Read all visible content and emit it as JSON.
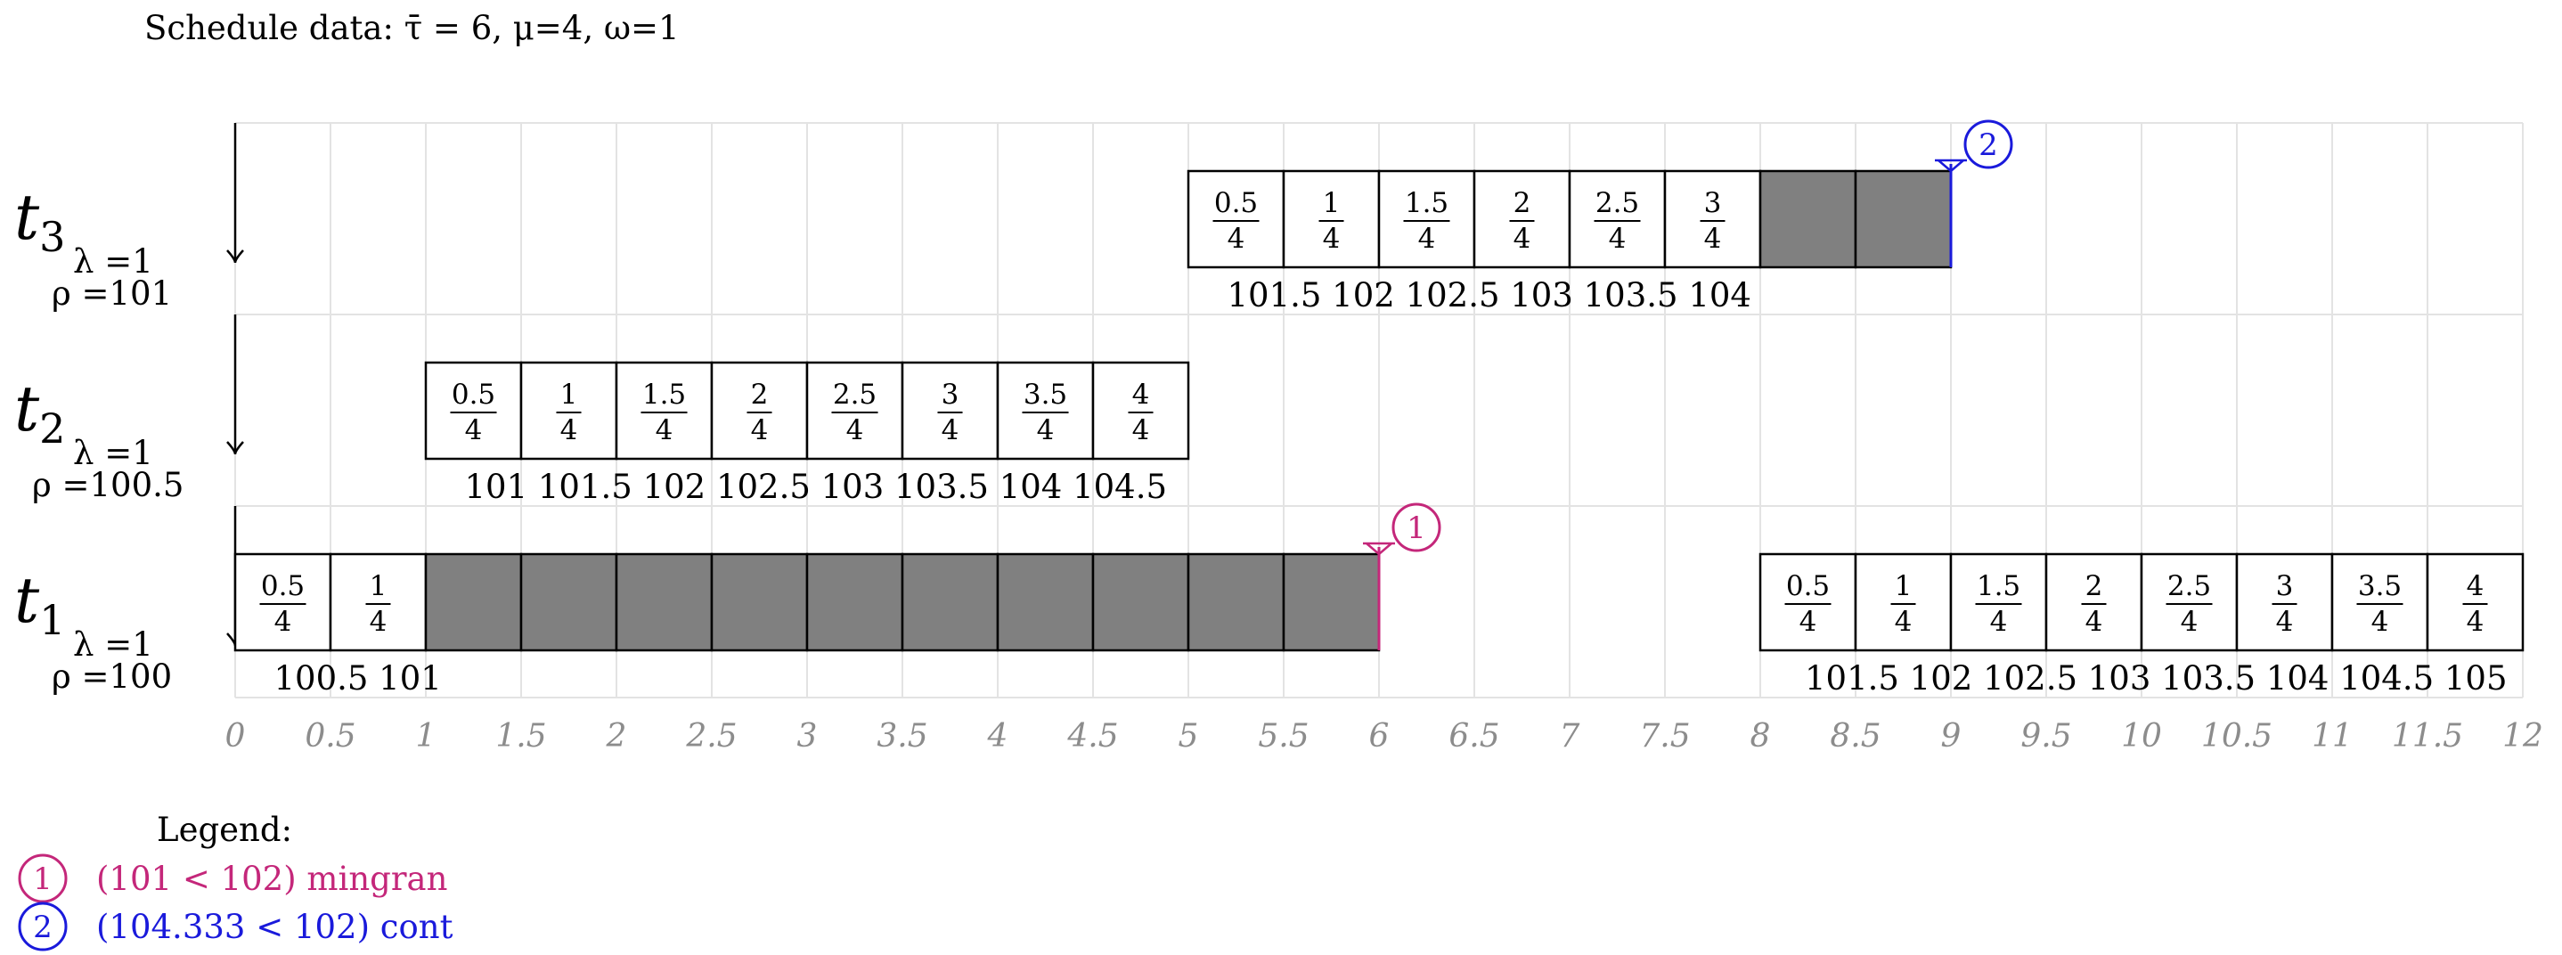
{
  "header": {
    "text": "Schedule data:  τ̄ = 6,  μ=4,  ω=1"
  },
  "axis": {
    "ticks": [
      "0",
      "0.5",
      "1",
      "1.5",
      "2",
      "2.5",
      "3",
      "3.5",
      "4",
      "4.5",
      "5",
      "5.5",
      "6",
      "6.5",
      "7",
      "7.5",
      "8",
      "8.5",
      "9",
      "9.5",
      "10",
      "10.5",
      "11",
      "11.5",
      "12"
    ]
  },
  "rows": [
    {
      "id": "t3",
      "name": "t",
      "sub": "3",
      "lambda": "λ =1",
      "rho": "ρ =101",
      "job_start": 5,
      "blocks": [
        {
          "num": "0.5",
          "den": "4"
        },
        {
          "num": "1",
          "den": "4"
        },
        {
          "num": "1.5",
          "den": "4"
        },
        {
          "num": "2",
          "den": "4"
        },
        {
          "num": "2.5",
          "den": "4"
        },
        {
          "num": "3",
          "den": "4"
        },
        {
          "fill": "gray"
        },
        {
          "fill": "gray"
        }
      ],
      "under_labels": [
        "101.5",
        "102",
        "102.5",
        "103",
        "103.5",
        "104"
      ],
      "marker": {
        "at": 9,
        "label": "2",
        "color": "#1a1adb"
      }
    },
    {
      "id": "t2",
      "name": "t",
      "sub": "2",
      "lambda": "λ =1",
      "rho": "ρ =100.5",
      "job_start": 1,
      "blocks": [
        {
          "num": "0.5",
          "den": "4"
        },
        {
          "num": "1",
          "den": "4"
        },
        {
          "num": "1.5",
          "den": "4"
        },
        {
          "num": "2",
          "den": "4"
        },
        {
          "num": "2.5",
          "den": "4"
        },
        {
          "num": "3",
          "den": "4"
        },
        {
          "num": "3.5",
          "den": "4"
        },
        {
          "num": "4",
          "den": "4"
        }
      ],
      "under_labels": [
        "101",
        "101.5",
        "102",
        "102.5",
        "103",
        "103.5",
        "104",
        "104.5"
      ]
    },
    {
      "id": "t1",
      "name": "t",
      "sub": "1",
      "lambda": "λ =1",
      "rho": "ρ =100",
      "job_start": 0,
      "blocks": [
        {
          "num": "0.5",
          "den": "4"
        },
        {
          "num": "1",
          "den": "4"
        },
        {
          "fill": "gray"
        },
        {
          "fill": "gray"
        },
        {
          "fill": "gray"
        },
        {
          "fill": "gray"
        },
        {
          "fill": "gray"
        },
        {
          "fill": "gray"
        },
        {
          "fill": "gray"
        },
        {
          "fill": "gray"
        },
        {
          "fill": "gray"
        },
        {
          "fill": "gray"
        }
      ],
      "under_labels": [
        "100.5",
        "101"
      ],
      "marker": {
        "at": 6,
        "label": "1",
        "color": "#c4277a"
      },
      "second_job": {
        "start": 8,
        "blocks": [
          {
            "num": "0.5",
            "den": "4"
          },
          {
            "num": "1",
            "den": "4"
          },
          {
            "num": "1.5",
            "den": "4"
          },
          {
            "num": "2",
            "den": "4"
          },
          {
            "num": "2.5",
            "den": "4"
          },
          {
            "num": "3",
            "den": "4"
          },
          {
            "num": "3.5",
            "den": "4"
          },
          {
            "num": "4",
            "den": "4"
          }
        ],
        "under_labels": [
          "101.5",
          "102",
          "102.5",
          "103",
          "103.5",
          "104",
          "104.5",
          "105"
        ]
      }
    }
  ],
  "legend": {
    "title": "Legend:",
    "items": [
      {
        "label": "1",
        "text": "(101 < 102) mingran",
        "color": "#c4277a"
      },
      {
        "label": "2",
        "text": "(104.333 < 102) cont",
        "color": "#1a1adb"
      }
    ]
  },
  "colors": {
    "grid": "#e3e3e3",
    "gray_block": "#808080"
  }
}
